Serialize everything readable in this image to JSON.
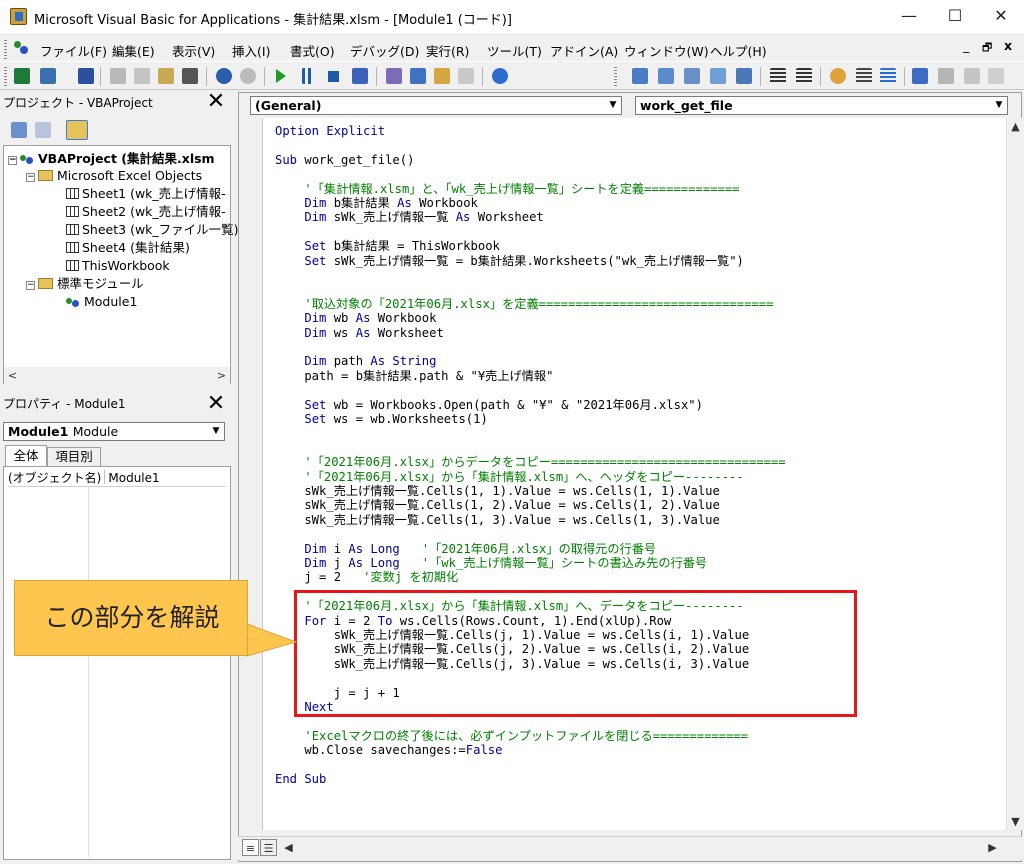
{
  "window": {
    "title": "Microsoft Visual Basic for Applications - 集計結果.xlsm - [Module1 (コード)]",
    "minimize": "—",
    "maximize": "☐",
    "close": "✕",
    "doc_minimize": "_",
    "doc_restore": "🗗",
    "doc_close": "x"
  },
  "menu": [
    "ファイル(F)",
    "編集(E)",
    "表示(V)",
    "挿入(I)",
    "書式(O)",
    "デバッグ(D)",
    "実行(R)",
    "ツール(T)",
    "アドイン(A)",
    "ウィンドウ(W)",
    "ヘルプ(H)"
  ],
  "project_panel": {
    "title": "プロジェクト - VBAProject",
    "root": "VBAProject (集計結果.xlsm",
    "excel_objects": "Microsoft Excel Objects",
    "items": [
      "Sheet1 (wk_売上げ情報-",
      "Sheet2 (wk_売上げ情報-",
      "Sheet3 (wk_ファイル一覧)",
      "Sheet4 (集計結果)",
      "ThisWorkbook"
    ],
    "modules_folder": "標準モジュール",
    "module": "Module1"
  },
  "properties_panel": {
    "title": "プロパティ - Module1",
    "object_name": "Module1",
    "object_type": "Module",
    "tab_all": "全体",
    "tab_category": "項目別",
    "prop_name": "(オブジェクト名)",
    "prop_value": "Module1"
  },
  "code_window": {
    "object_combo": "(General)",
    "procedure_combo": "work_get_file",
    "lines": [
      [
        [
          "kw",
          "Option Explicit"
        ]
      ],
      [],
      [
        [
          "kw",
          "Sub "
        ],
        [
          "",
          "work_get_file()"
        ]
      ],
      [],
      [
        [
          "",
          "    "
        ],
        [
          "cm",
          "'「集計情報.xlsm」と、「wk_売上げ情報一覧」シートを定義============="
        ]
      ],
      [
        [
          "",
          "    "
        ],
        [
          "kw",
          "Dim "
        ],
        [
          "",
          "b集計結果 "
        ],
        [
          "kw",
          "As "
        ],
        [
          "",
          "Workbook"
        ]
      ],
      [
        [
          "",
          "    "
        ],
        [
          "kw",
          "Dim "
        ],
        [
          "",
          "sWk_売上げ情報一覧 "
        ],
        [
          "kw",
          "As "
        ],
        [
          "",
          "Worksheet"
        ]
      ],
      [],
      [
        [
          "",
          "    "
        ],
        [
          "kw",
          "Set "
        ],
        [
          "",
          "b集計結果 = ThisWorkbook"
        ]
      ],
      [
        [
          "",
          "    "
        ],
        [
          "kw",
          "Set "
        ],
        [
          "",
          "sWk_売上げ情報一覧 = b集計結果.Worksheets(\"wk_売上げ情報一覧\")"
        ]
      ],
      [],
      [],
      [
        [
          "",
          "    "
        ],
        [
          "cm",
          "'取込対象の「2021年06月.xlsx」を定義================================"
        ]
      ],
      [
        [
          "",
          "    "
        ],
        [
          "kw",
          "Dim "
        ],
        [
          "",
          "wb "
        ],
        [
          "kw",
          "As "
        ],
        [
          "",
          "Workbook"
        ]
      ],
      [
        [
          "",
          "    "
        ],
        [
          "kw",
          "Dim "
        ],
        [
          "",
          "ws "
        ],
        [
          "kw",
          "As "
        ],
        [
          "",
          "Worksheet"
        ]
      ],
      [],
      [
        [
          "",
          "    "
        ],
        [
          "kw",
          "Dim "
        ],
        [
          "",
          "path "
        ],
        [
          "kw",
          "As String"
        ]
      ],
      [
        [
          "",
          "    path = b集計結果.path & \"¥売上げ情報\""
        ]
      ],
      [],
      [
        [
          "",
          "    "
        ],
        [
          "kw",
          "Set "
        ],
        [
          "",
          "wb = Workbooks.Open(path & \"¥\" & \"2021年06月.xlsx\")"
        ]
      ],
      [
        [
          "",
          "    "
        ],
        [
          "kw",
          "Set "
        ],
        [
          "",
          "ws = wb.Worksheets(1)"
        ]
      ],
      [],
      [],
      [
        [
          "",
          "    "
        ],
        [
          "cm",
          "'「2021年06月.xlsx」からデータをコピー================================"
        ]
      ],
      [
        [
          "",
          "    "
        ],
        [
          "cm",
          "'「2021年06月.xlsx」から「集計情報.xlsm」へ、ヘッダをコピー--------"
        ]
      ],
      [
        [
          "",
          "    sWk_売上げ情報一覧.Cells(1, 1).Value = ws.Cells(1, 1).Value"
        ]
      ],
      [
        [
          "",
          "    sWk_売上げ情報一覧.Cells(1, 2).Value = ws.Cells(1, 2).Value"
        ]
      ],
      [
        [
          "",
          "    sWk_売上げ情報一覧.Cells(1, 3).Value = ws.Cells(1, 3).Value"
        ]
      ],
      [],
      [
        [
          "",
          "    "
        ],
        [
          "kw",
          "Dim "
        ],
        [
          "",
          "i "
        ],
        [
          "kw",
          "As Long   "
        ],
        [
          "cm",
          "'「2021年06月.xlsx」の取得元の行番号"
        ]
      ],
      [
        [
          "",
          "    "
        ],
        [
          "kw",
          "Dim "
        ],
        [
          "",
          "j "
        ],
        [
          "kw",
          "As Long   "
        ],
        [
          "cm",
          "'「wk_売上げ情報一覧」シートの書込み先の行番号"
        ]
      ],
      [
        [
          "",
          "    j = 2   "
        ],
        [
          "cm",
          "'変数j を初期化"
        ]
      ],
      [],
      [
        [
          "",
          "    "
        ],
        [
          "cm",
          "'「2021年06月.xlsx」から「集計情報.xlsm」へ、データをコピー--------"
        ]
      ],
      [
        [
          "",
          "    "
        ],
        [
          "kw",
          "For "
        ],
        [
          "",
          "i = 2 "
        ],
        [
          "kw",
          "To "
        ],
        [
          "",
          "ws.Cells(Rows.Count, 1).End(xlUp).Row"
        ]
      ],
      [
        [
          "",
          "        sWk_売上げ情報一覧.Cells(j, 1).Value = ws.Cells(i, 1).Value"
        ]
      ],
      [
        [
          "",
          "        sWk_売上げ情報一覧.Cells(j, 2).Value = ws.Cells(i, 2).Value"
        ]
      ],
      [
        [
          "",
          "        sWk_売上げ情報一覧.Cells(j, 3).Value = ws.Cells(i, 3).Value"
        ]
      ],
      [],
      [
        [
          "",
          "        j = j + 1"
        ]
      ],
      [
        [
          "",
          "    "
        ],
        [
          "kw",
          "Next"
        ]
      ],
      [],
      [
        [
          "",
          "    "
        ],
        [
          "cm",
          "'Excelマクロの終了後には、必ずインプットファイルを閉じる============="
        ]
      ],
      [
        [
          "",
          "    wb.Close savechanges:="
        ],
        [
          "kw",
          "False"
        ]
      ],
      [],
      [
        [
          "kw",
          "End Sub"
        ]
      ]
    ]
  },
  "callout": {
    "text": "この部分を解説"
  },
  "colors": {
    "keyword": "#00009a",
    "comment": "#008000",
    "highlight": "#e8151b",
    "callout": "#ffc64f"
  }
}
